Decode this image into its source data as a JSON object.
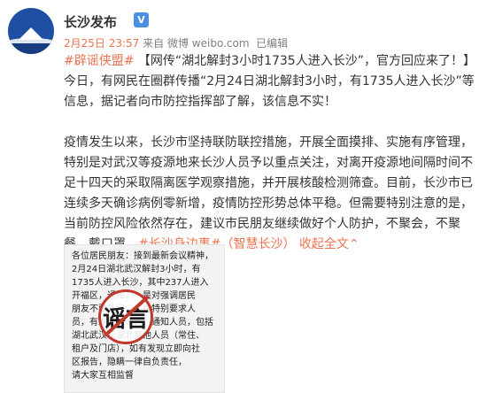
{
  "account": {
    "name": "长沙发布"
  },
  "meta": {
    "time": "2月25日 23:57",
    "from_label": "来自",
    "source": "微博 weibo.com",
    "edited": "已编辑"
  },
  "post": {
    "p1_tag": "#辟谣侠盟#",
    "p1_text": " 【网传“湖北解封3小时1735人进入长沙”，官方回应来了！】今日，有网民在圈群传播“2月24日湖北解封3小时，有1735人进入长沙”等信息，据记者向市防控指挥部了解，该信息不实！",
    "p2_text": "疫情发生以来，长沙市坚持联防联控措施，开展全面摸排、实施有序管理，特别是对武汉等疫源地来长沙人员予以重点关注，对离开疫源地间隔时间不足十四天的采取隔离医学观察措施，并开展核酸检测筛查。目前，长沙市已连续多天确诊病例零新增，疫情防控形势总体平稳。但需要特别注意的是，当前防控风险依然存在，建议市民朋友继续做好个人防护，不聚会，不聚餐，戴口罩。",
    "p2_tag": "#长沙身边事#",
    "p2_mention": "（智慧长沙）",
    "p2_collapse": "收起全文",
    "p2_collapse_icon": "chevron-up-icon"
  },
  "image": {
    "lines": [
      "各位居民朋友：接到最新会议精神，",
      "2月24日湖北武汉解封3小时，有",
      "1735人进入长沙，其中237人进入",
      "开福区，通知，一是对强调居民",
      "朋友不要外出，二是特别要求人",
      "员，有发现入境的，通知人员，包括",
      "湖北武汉和湖北其他人员（常住、",
      "租户及门店），如有发现立即向社",
      "区报告，隐瞒一律自负责任，",
      "请大家互相监督"
    ],
    "stamp_text": "谣言",
    "stamp_color": "#c0392b"
  },
  "colors": {
    "link": "#eb7350",
    "vip_badge": "#4a90e2",
    "avatar_bg": "#1e4fa3"
  }
}
